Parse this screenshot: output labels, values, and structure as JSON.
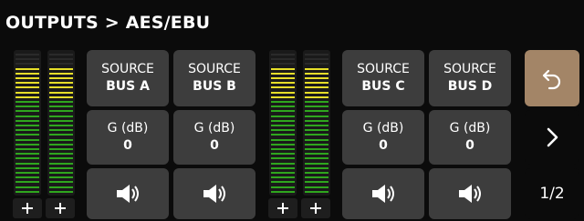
{
  "header": {
    "title": "OUTPUTS > AES/EBU"
  },
  "colors": {
    "meter_green": "#2fa61e",
    "meter_yellow": "#e6de29",
    "button_bg": "#3d3d3d",
    "back_button_bg": "#a38567"
  },
  "meter_groups": [
    {
      "plus_icon": "plus-icon"
    },
    {
      "plus_icon": "plus-icon"
    }
  ],
  "channels": [
    {
      "source_label": "SOURCE",
      "source_value": "BUS A",
      "gain_label": "G (dB)",
      "gain_value": "0",
      "speaker_icon": "speaker-icon"
    },
    {
      "source_label": "SOURCE",
      "source_value": "BUS B",
      "gain_label": "G (dB)",
      "gain_value": "0",
      "speaker_icon": "speaker-icon"
    },
    {
      "source_label": "SOURCE",
      "source_value": "BUS C",
      "gain_label": "G (dB)",
      "gain_value": "0",
      "speaker_icon": "speaker-icon"
    },
    {
      "source_label": "SOURCE",
      "source_value": "BUS D",
      "gain_label": "G (dB)",
      "gain_value": "0",
      "speaker_icon": "speaker-icon"
    }
  ],
  "side": {
    "back_icon": "back-arrow-icon",
    "next_icon": "chevron-right-icon",
    "page_label": "1/2"
  }
}
